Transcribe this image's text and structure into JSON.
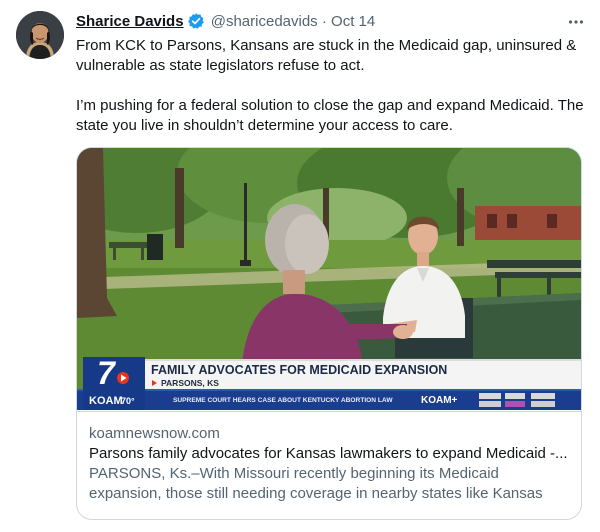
{
  "author": {
    "name": "Sharice Davids",
    "handle": "@sharicedavids",
    "separator": "·",
    "date": "Oct 14",
    "verified_color": "#1d9bf0"
  },
  "tweet": {
    "paragraphs": [
      "From KCK to Parsons, Kansans are stuck in the Medicaid gap, uninsured & vulnerable as state legislators refuse to act.",
      "I’m pushing for a federal solution to close the gap and expand Medicaid. The state you live in shouldn’t determine your access to care."
    ]
  },
  "more_icon": "more-options-icon",
  "media": {
    "station_number": "7",
    "station_name": "KOAM",
    "temperature": "70°",
    "headline": "FAMILY ADVOCATES FOR MEDICAID EXPANSION",
    "location": "PARSONS, KS",
    "ticker": "SUPREME COURT HEARS CASE ABOUT KENTUCKY ABORTION LAW",
    "ticker_brand": "KOAM+",
    "accent": "#e8361b",
    "banner_blue": "#1a3d8f"
  },
  "card": {
    "domain": "koamnewsnow.com",
    "title": "Parsons family advocates for Kansas lawmakers to expand Medicaid -...",
    "description": "PARSONS, Ks.–With Missouri recently beginning its Medicaid expansion, those still needing coverage in nearby states like Kansas ar..."
  }
}
